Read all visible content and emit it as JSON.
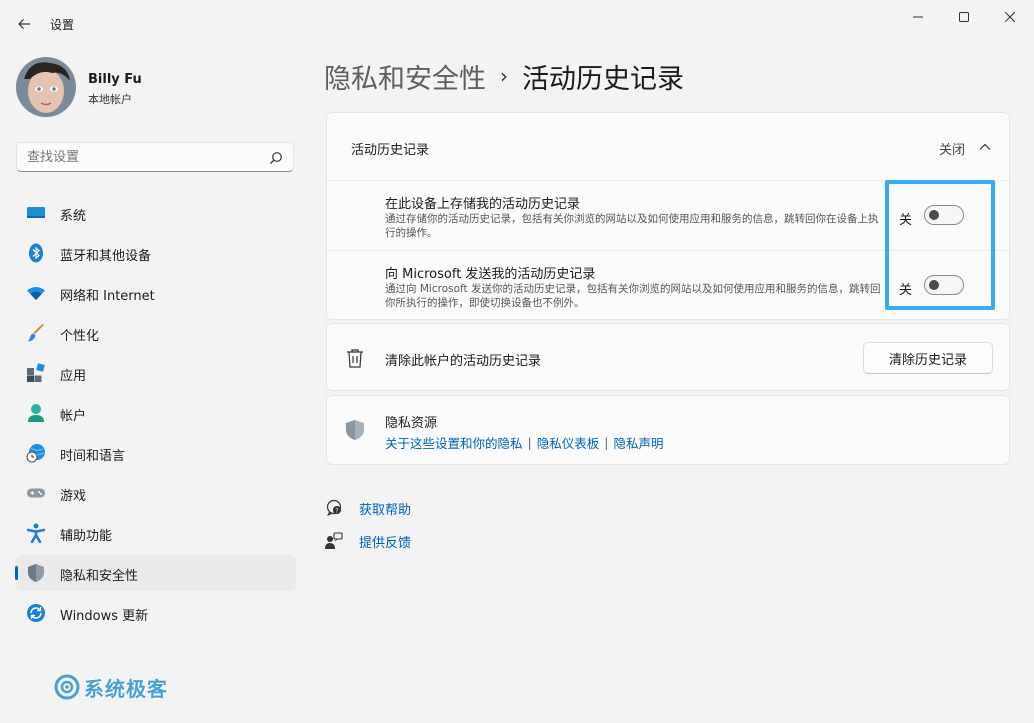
{
  "app": {
    "title": "设置"
  },
  "profile": {
    "name": "Billy Fu",
    "account_type": "本地帐户"
  },
  "search": {
    "placeholder": "查找设置"
  },
  "sidebar": {
    "items": [
      {
        "label": "系统",
        "icon": "monitor-icon"
      },
      {
        "label": "蓝牙和其他设备",
        "icon": "bluetooth-icon"
      },
      {
        "label": "网络和 Internet",
        "icon": "wifi-icon"
      },
      {
        "label": "个性化",
        "icon": "paintbrush-icon"
      },
      {
        "label": "应用",
        "icon": "apps-icon"
      },
      {
        "label": "帐户",
        "icon": "person-icon"
      },
      {
        "label": "时间和语言",
        "icon": "globe-clock-icon"
      },
      {
        "label": "游戏",
        "icon": "gamepad-icon"
      },
      {
        "label": "辅助功能",
        "icon": "accessibility-icon"
      },
      {
        "label": "隐私和安全性",
        "icon": "shield-icon",
        "active": true
      },
      {
        "label": "Windows 更新",
        "icon": "windows-update-icon"
      }
    ]
  },
  "breadcrumb": {
    "parent": "隐私和安全性",
    "separator": "›",
    "current": "活动历史记录"
  },
  "activity_card": {
    "title": "活动历史记录",
    "state": "关闭",
    "rows": [
      {
        "title": "在此设备上存储我的活动历史记录",
        "description": "通过存储你的活动历史记录，包括有关你浏览的网站以及如何使用应用和服务的信息，跳转回你在设备上执行的操作。",
        "state": "关",
        "on": false
      },
      {
        "title": "向 Microsoft 发送我的活动历史记录",
        "description": "通过向 Microsoft 发送你的活动历史记录，包括有关你浏览的网站以及如何使用应用和服务的信息，跳转回你所执行的操作，即使切换设备也不例外。",
        "state": "关",
        "on": false
      }
    ]
  },
  "clear_card": {
    "title": "清除此帐户的活动历史记录",
    "button": "清除历史记录"
  },
  "privacy_resources": {
    "title": "隐私资源",
    "links": [
      "关于这些设置和你的隐私",
      "隐私仪表板",
      "隐私声明"
    ],
    "separator": "|"
  },
  "help": {
    "get_help": "获取帮助",
    "feedback": "提供反馈"
  },
  "watermark": {
    "text": "系统极客"
  },
  "colors": {
    "accent": "#0067c0",
    "link": "#0060b8",
    "highlight": "#3aabee"
  }
}
